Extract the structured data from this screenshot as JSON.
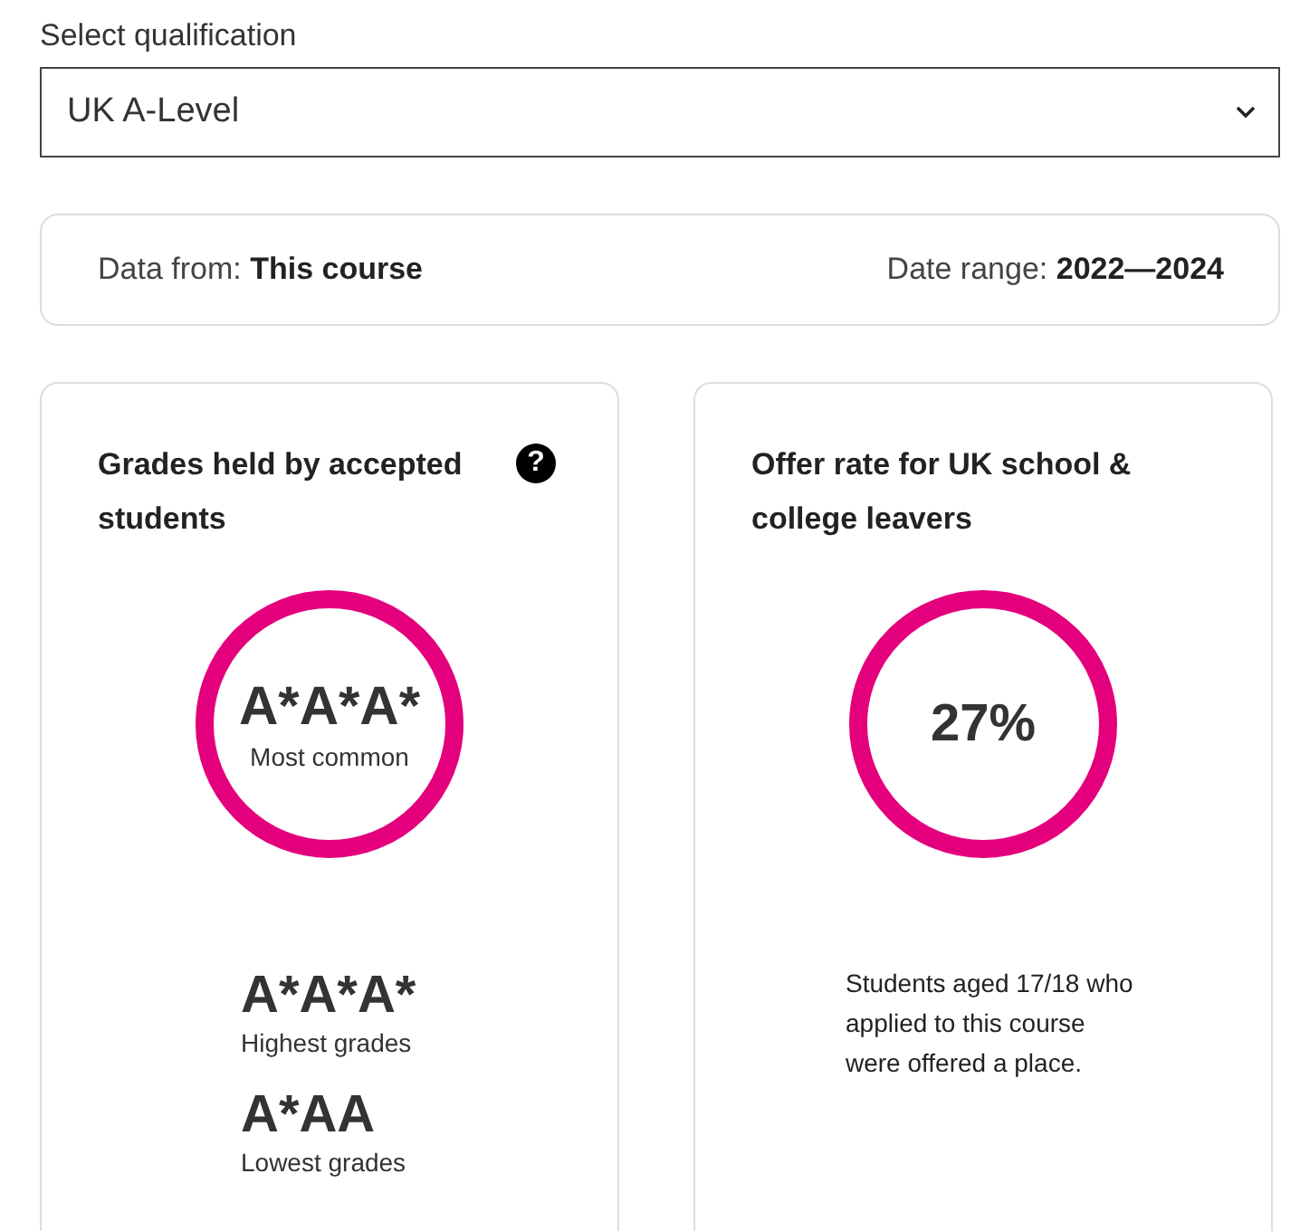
{
  "qualification_select": {
    "label": "Select qualification",
    "value": "UK A-Level"
  },
  "data_source": {
    "label": "Data from:",
    "value": "This course",
    "date_label": "Date range:",
    "date_value": "2022—2024"
  },
  "cards": [
    {
      "kind": "grades",
      "title": "Grades held by accepted students",
      "help": "?",
      "ring_value": "A*A*A*",
      "ring_caption": "Most common",
      "stats": [
        {
          "value": "A*A*A*",
          "caption": "Highest grades"
        },
        {
          "value": "A*AA",
          "caption": "Lowest grades"
        }
      ]
    },
    {
      "kind": "offer_rate",
      "title": "Offer rate for UK school & college leavers",
      "ring_value": "27%",
      "description": "Students aged 17/18 who applied to this course were offered a place."
    }
  ]
}
